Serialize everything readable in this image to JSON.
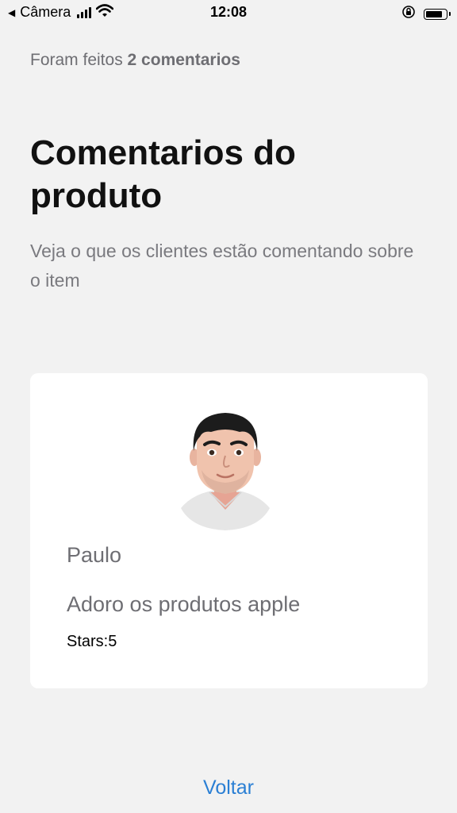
{
  "status_bar": {
    "back_app": "Câmera",
    "time": "12:08"
  },
  "comments": {
    "count_prefix": "Foram feitos",
    "count_value": "2 comentarios",
    "title": "Comentarios do produto",
    "subtitle": "Veja o que os clientes estão comentando sobre o item"
  },
  "card": {
    "author": "Paulo",
    "comment": "Adoro os produtos apple",
    "stars": "Stars:5"
  },
  "footer": {
    "back_label": "Voltar"
  },
  "colors": {
    "background": "#f2f2f2",
    "card": "#ffffff",
    "link": "#2a7fd4",
    "muted_text": "#6e6e73"
  }
}
